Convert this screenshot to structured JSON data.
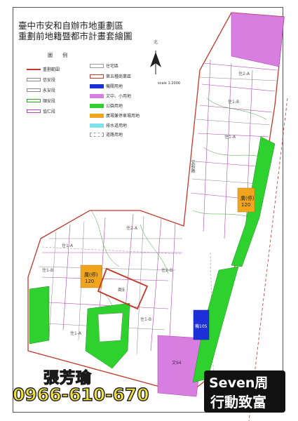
{
  "title": {
    "line1": "臺中市安和自辦市地重劃區",
    "line2": "重劃前地籍暨都市計畫套繪圖"
  },
  "legend": {
    "heading": "圖  例",
    "left": [
      {
        "label": "重劃範圍",
        "color": "#c0392b",
        "style": "line"
      },
      {
        "label": "信安段",
        "color": "#888888",
        "style": "double"
      },
      {
        "label": "永安段",
        "color": "#888888",
        "style": "double"
      },
      {
        "label": "順安段",
        "color": "#39a439",
        "style": "double"
      },
      {
        "label": "協仁段",
        "color": "#b04ab0",
        "style": "double"
      }
    ],
    "right": [
      {
        "label": "住宅區",
        "color": "#ffffff",
        "style": "box"
      },
      {
        "label": "第五種商業區",
        "color": "#c0392b",
        "style": "outline"
      },
      {
        "label": "機關用地",
        "color": "#1d2fd6",
        "style": "box"
      },
      {
        "label": "文中、小用地",
        "color": "#d77ee0",
        "style": "box"
      },
      {
        "label": "公園用地",
        "color": "#2fd12f",
        "style": "box"
      },
      {
        "label": "廣場兼停車場用地",
        "color": "#f0a51c",
        "style": "box"
      },
      {
        "label": "排水道用地",
        "color": "#7fe3ee",
        "style": "box"
      },
      {
        "label": "道路用地",
        "color": "#ffffff",
        "style": "box"
      }
    ]
  },
  "north_label": "北",
  "scale": "scale 1:2000",
  "map_labels": {
    "road_name": "安和路",
    "plaza_label_1": "廣(停)",
    "plaza_value_1": "120",
    "plaza_label_2": "廣(停)",
    "plaza_value_2": "120",
    "gov_label": "機105",
    "school_label": "文94",
    "zone_r1": "住1-A",
    "zone_r2": "住1-B",
    "zone_r3": "住2-A",
    "zone_r4": "住2-B",
    "commercial": "商5"
  },
  "promo": {
    "name": "張芳瑜",
    "phone": "0966-610-670",
    "brand_line1": "Seven周",
    "brand_line2": "行動致富"
  }
}
